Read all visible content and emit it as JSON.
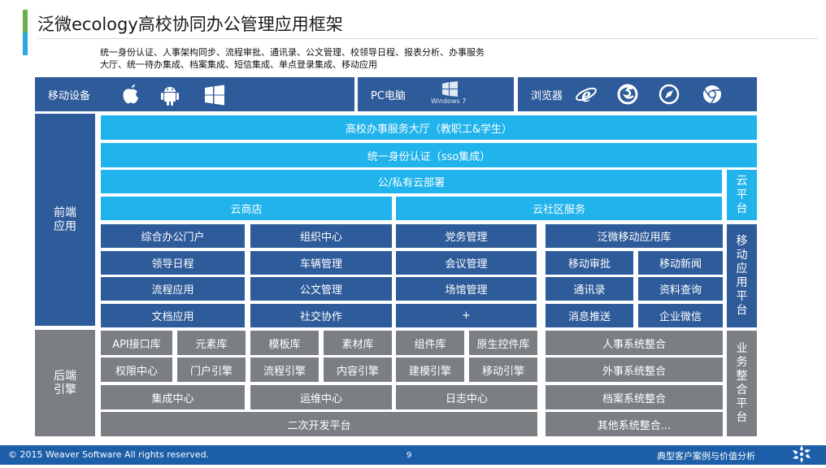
{
  "header": {
    "title": "泛微ecology高校协同办公管理应用框架",
    "description": "统一身份认证、人事架构同步、流程审批、通讯录、公文管理、校领导日程、报表分析、办事服务大厅、统一待办集成、档案集成、短信集成、单点登录集成、移动应用"
  },
  "devices": {
    "mobile_label": "移动设备",
    "pc_label": "PC电脑",
    "windows_caption": "Windows 7",
    "browser_label": "浏览器"
  },
  "front": {
    "label": "前端应用",
    "rows": {
      "service_hall": "高校办事服务大厅（教职工&学生）",
      "sso": "统一身份认证（sso集成）",
      "cloud_deploy": "公/私有云部署",
      "cloud_store": "云商店",
      "cloud_community": "云社区服务"
    },
    "cloud_platform": "云平台",
    "mobile_platform": "移动应用平台",
    "grid": {
      "r1": [
        "综合办公门户",
        "组织中心",
        "党务管理",
        "泛微移动应用库"
      ],
      "r2": [
        "领导日程",
        "车辆管理",
        "会议管理",
        "移动审批",
        "移动新闻"
      ],
      "r3": [
        "流程应用",
        "公文管理",
        "场馆管理",
        "通讯录",
        "资料查询"
      ],
      "r4": [
        "文档应用",
        "社交协作",
        "+",
        "消息推送",
        "企业微信"
      ]
    }
  },
  "back": {
    "label": "后端引擎",
    "integration_platform": "业务整合平台",
    "r1": [
      "API接口库",
      "元素库",
      "模板库",
      "素材库",
      "组件库",
      "原生控件库",
      "人事系统整合"
    ],
    "r2": [
      "权限中心",
      "门户引擎",
      "流程引擎",
      "内容引擎",
      "建模引擎",
      "移动引擎",
      "外事系统整合"
    ],
    "r3": [
      "集成中心",
      "运维中心",
      "日志中心",
      "档案系统整合"
    ],
    "r4": [
      "二次开发平台",
      "其他系统整合..."
    ]
  },
  "footer": {
    "copyright": "© 2015 Weaver  Software All rights reserved.",
    "page": "9",
    "section": "典型客户案例与价值分析"
  },
  "colors": {
    "navy": "#2e5b9a",
    "cyan": "#20b3ec",
    "gray": "#7b7f84",
    "footer": "#1c5fa8"
  }
}
